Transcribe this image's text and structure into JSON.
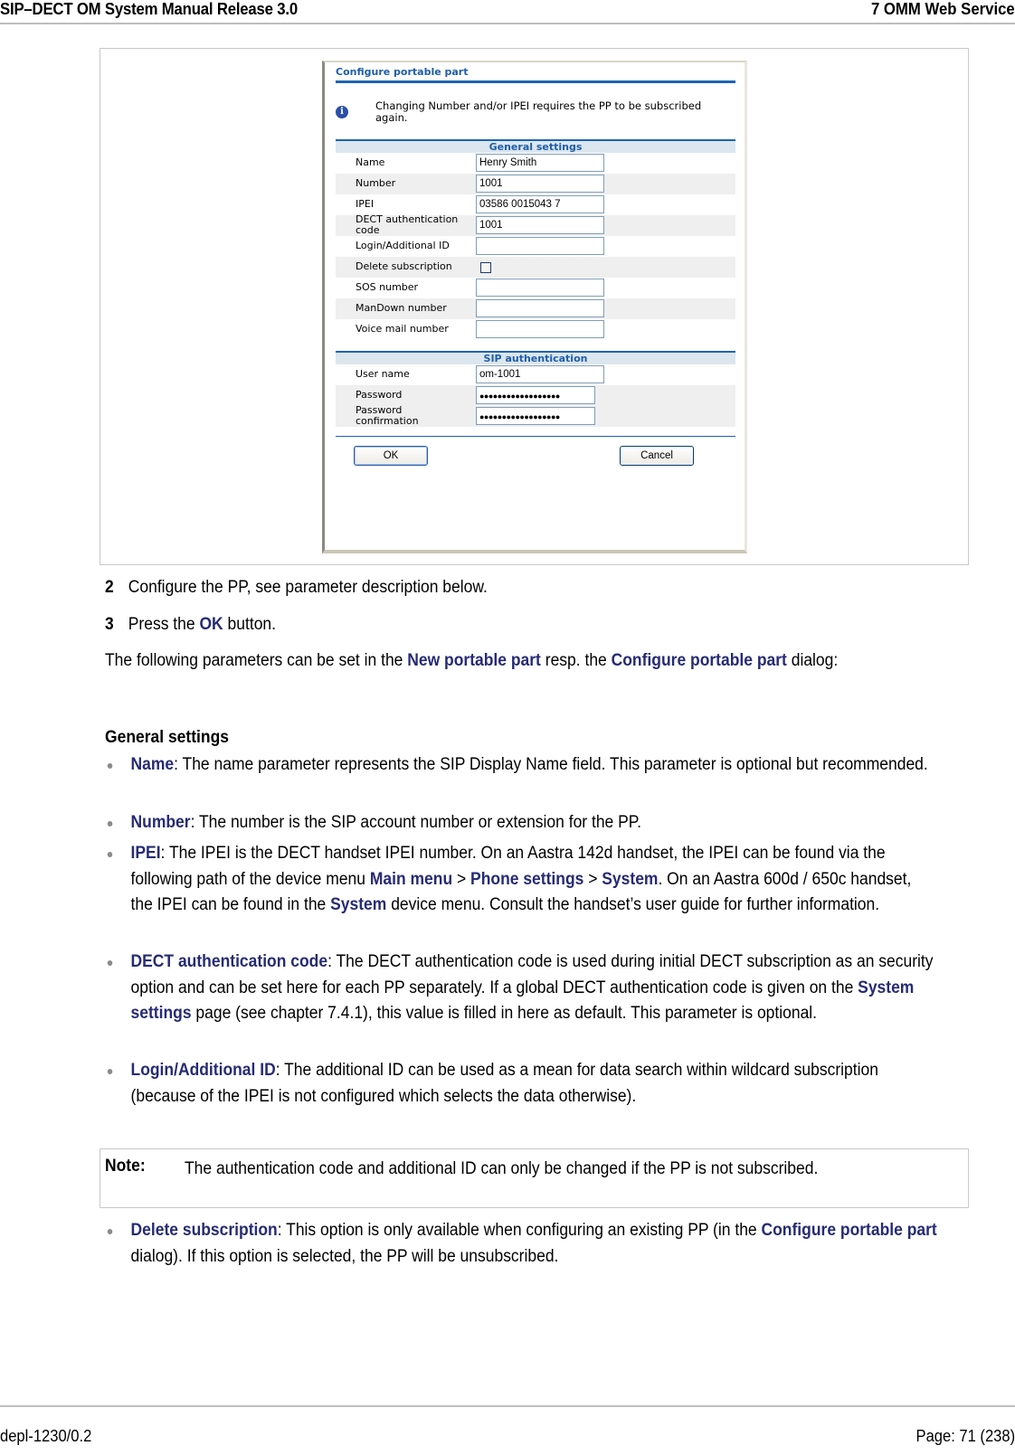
{
  "header": {
    "left": "SIP–DECT OM System Manual Release 3.0",
    "right": "7 OMM Web Service"
  },
  "dialog": {
    "title": "Configure portable part",
    "info_icon": "info-icon",
    "info_message": "Changing Number and/or IPEI requires the PP to be subscribed again.",
    "general_section": "General settings",
    "general_fields": [
      {
        "label": "Name",
        "value": "Henry Smith",
        "type": "text"
      },
      {
        "label": "Number",
        "value": "1001",
        "type": "text"
      },
      {
        "label": "IPEI",
        "value": "03586 0015043 7",
        "type": "text"
      },
      {
        "label": "DECT authentication code",
        "value": "1001",
        "type": "text"
      },
      {
        "label": "Login/Additional ID",
        "value": "",
        "type": "text"
      },
      {
        "label": "Delete subscription",
        "checked": false,
        "type": "checkbox"
      },
      {
        "label": "SOS number",
        "value": "",
        "type": "text"
      },
      {
        "label": "ManDown number",
        "value": "",
        "type": "text"
      },
      {
        "label": "Voice mail number",
        "value": "",
        "type": "text"
      }
    ],
    "sip_section": "SIP authentication",
    "sip_fields": [
      {
        "label": "User name",
        "value": "om-1001",
        "type": "text"
      },
      {
        "label": "Password",
        "value": "●●●●●●●●●●●●●●●●●●",
        "type": "password"
      },
      {
        "label": "Password confirmation",
        "value": "●●●●●●●●●●●●●●●●●●",
        "type": "password"
      }
    ],
    "ok_label": "OK",
    "cancel_label": "Cancel"
  },
  "steps": [
    {
      "num": "2",
      "text": "Configure the PP, see parameter description below."
    },
    {
      "num": "3",
      "pre": "Press the ",
      "highlight": "OK",
      "post": " button."
    }
  ],
  "intro": {
    "t1": "The following parameters can be set in the ",
    "h1": "New portable part",
    "t2": " resp. the ",
    "h2": "Configure portable part",
    "t3": " dialog:"
  },
  "section_heading": "General settings",
  "bullets": {
    "name": {
      "term": "Name",
      "text": ": The name parameter represents the SIP Display Name field. This parameter is optional but recommended."
    },
    "number": {
      "term": "Number",
      "text": ": The number is the SIP account number or extension for the PP."
    },
    "ipei": {
      "term": "IPEI",
      "t1": ": The IPEI is the DECT handset IPEI number. On an Aastra 142d handset, the IPEI can be found via the following path of the device menu ",
      "h1": "Main menu",
      "t2": " > ",
      "h2": "Phone settings",
      "t3": " > ",
      "h3": "System",
      "t4": ". On an Aastra 600d / 650c handset, the IPEI can be found in the ",
      "h4": "System",
      "t5": " device menu. Consult the handset’s user guide for further information."
    },
    "dect": {
      "term": "DECT authentication code",
      "t1": ": The DECT authentication code is used during initial DECT subscription as an security option and can be set here for each PP separately. If a global DECT authentication code is given on the ",
      "h1": "System settings",
      "t2": " page (see chapter 7.4.1), this value is filled in here as default. This parameter is optional."
    },
    "login": {
      "term": "Login/Additional ID",
      "text": ": The additional ID can be used as a mean for data search within wildcard subscription (because of the IPEI is not configured which selects the data otherwise)."
    },
    "delete": {
      "term": "Delete subscription",
      "t1": ": This option is only available when configuring an existing PP (in the ",
      "h1": "Configure portable part",
      "t2": " dialog). If this option is selected, the PP will be unsubscribed."
    }
  },
  "note": {
    "label": "Note:",
    "text": "The authentication code and additional ID can only be changed if the PP is not subscribed."
  },
  "footer": {
    "left": "depl-1230/0.2",
    "right": "Page: 71 (238)"
  }
}
